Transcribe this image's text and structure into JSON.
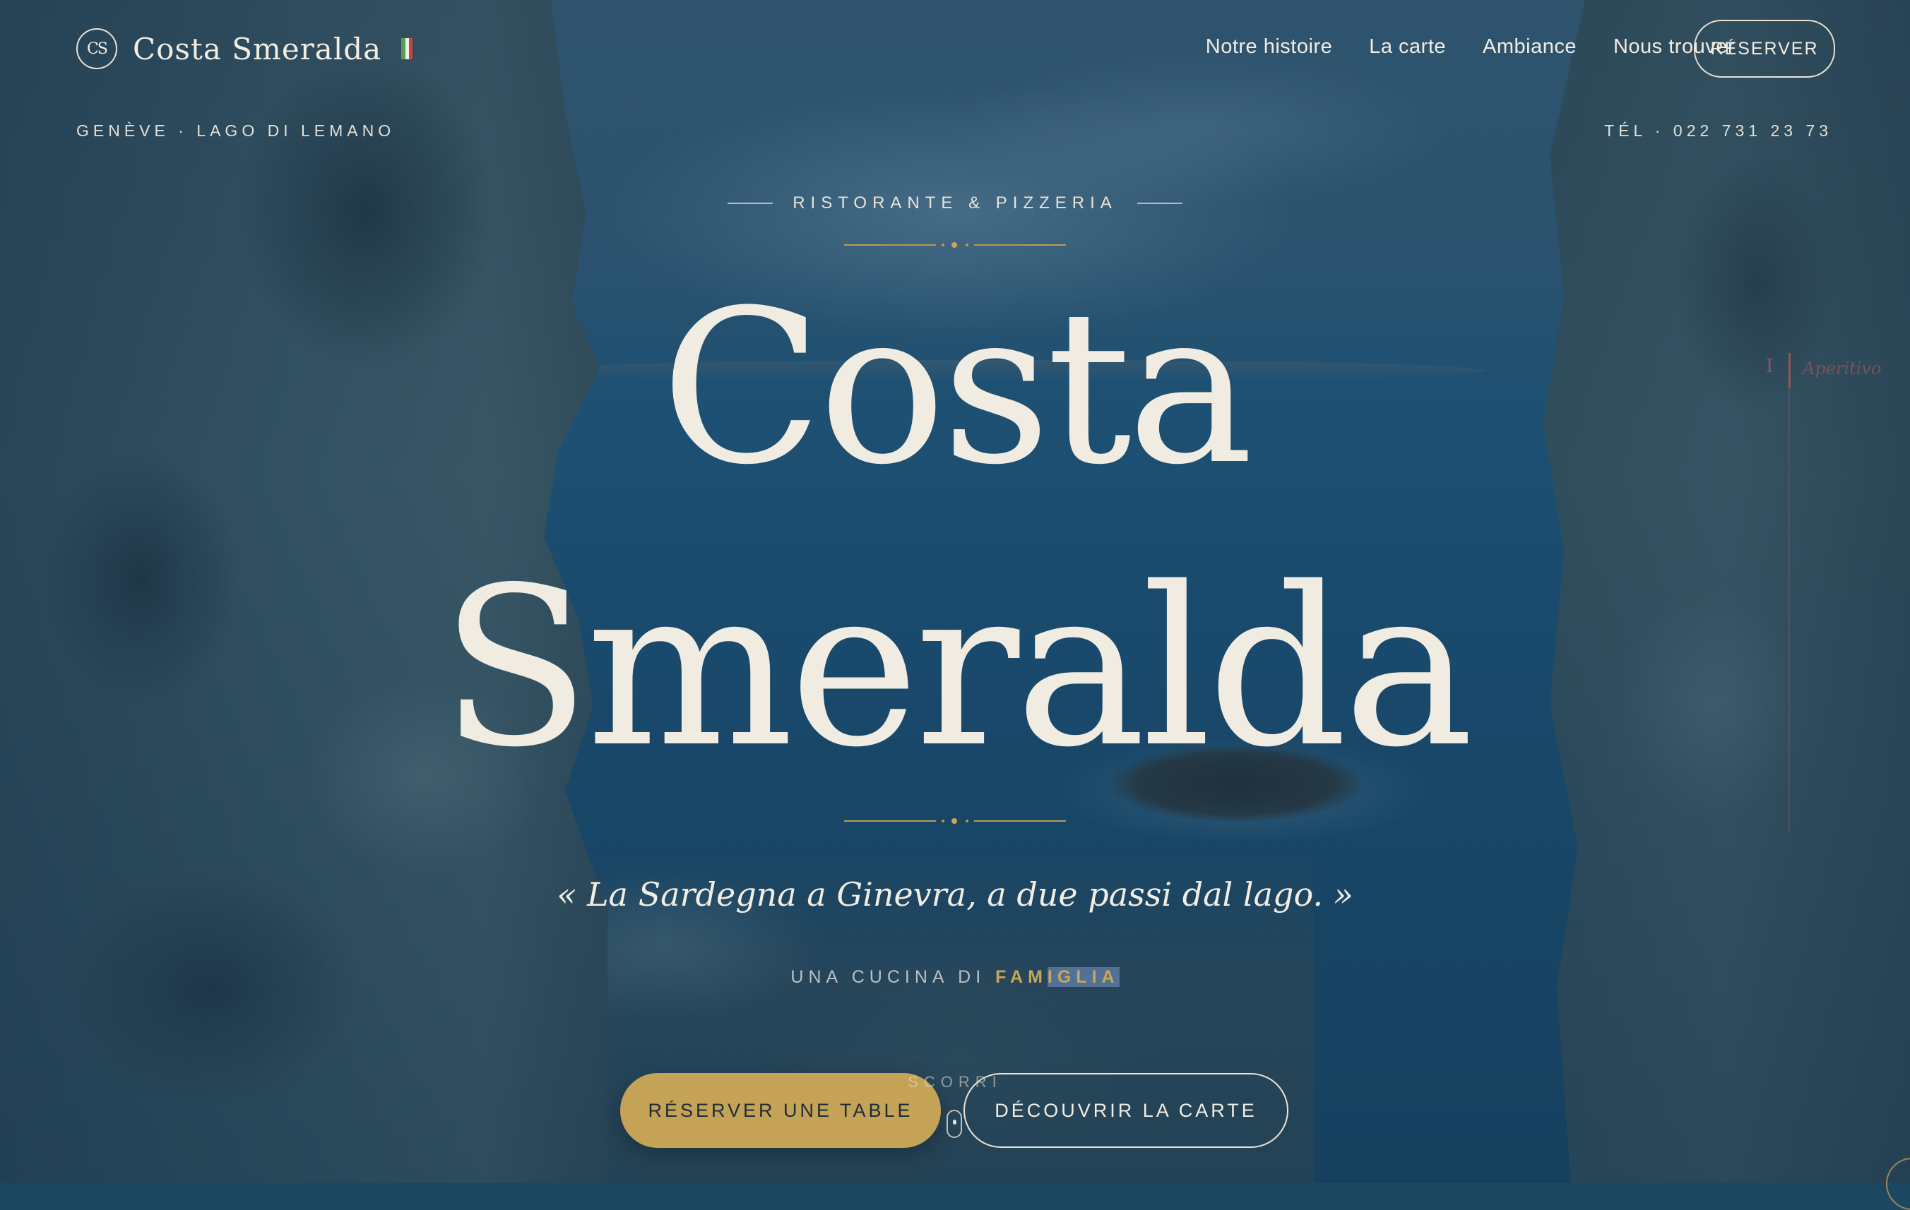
{
  "brand": {
    "name": "Costa Smeralda",
    "monogram": "CS"
  },
  "nav": {
    "items": [
      "Notre histoire",
      "La carte",
      "Ambiance",
      "Nous trouver"
    ],
    "reserve_label": "RÉSERVER"
  },
  "subheader": {
    "location": "GENÈVE · LAGO DI LEMANO",
    "phone": "TÉL · 022 731 23 73"
  },
  "hero": {
    "eyebrow": "RISTORANTE & PIZZERIA",
    "title_line1": "Costa",
    "title_line2": "Smeralda",
    "quote": "« La Sardegna a Ginevra, a due passi dal lago. »",
    "tagline_prefix": "UNA CUCINA DI",
    "tagline_accent_a": "FAM",
    "tagline_accent_b": "IGLIA",
    "scroll_label": "SCORRI",
    "primary_cta": "RÉSERVER UNE TABLE",
    "secondary_cta": "DÉCOUVRIR LA CARTE"
  },
  "side_rail": {
    "number": "I",
    "label": "Aperitivo"
  },
  "colors": {
    "accent_gold": "#c4a256",
    "text_cream": "#f2ede3",
    "flag": [
      "#5c9c5a",
      "#f1efe8",
      "#c9443f"
    ]
  },
  "icons": [
    "monogram-icon",
    "italian-flag-icon",
    "scroll-mouse-icon"
  ]
}
